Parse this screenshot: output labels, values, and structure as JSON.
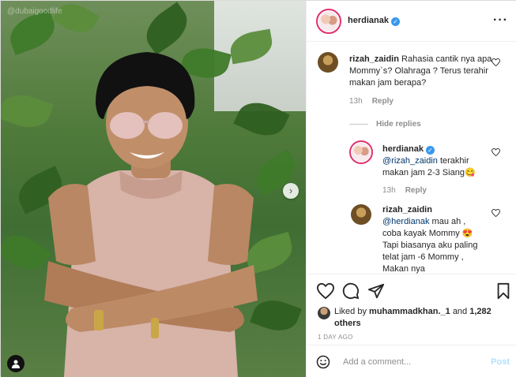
{
  "media": {
    "watermark": "@dubaigoodlife",
    "next_icon": "chevron-right-icon",
    "tag_icon": "user-tag-icon"
  },
  "header": {
    "username": "herdianak",
    "verified_icon": "verified-badge-icon",
    "more_icon": "ellipsis-icon"
  },
  "comments": [
    {
      "username": "rizah_zaidin",
      "text": "Rahasia cantik nya apa Mommy`s? Olahraga ? Terus terahir makan jam berapa?",
      "time": "13h",
      "reply_label": "Reply"
    }
  ],
  "hide_replies_label": "Hide replies",
  "replies": [
    {
      "username": "herdianak",
      "mention": "@rizah_zaidin",
      "text": "terakhir makan jam 2-3 Siang",
      "emoji": "😋",
      "time": "13h",
      "reply_label": "Reply"
    },
    {
      "username": "rizah_zaidin",
      "mention": "@herdianak",
      "text": "mau ah , coba kayak Mommy",
      "emoji": "😍",
      "text2": "Tapi biasanya aku paling telat jam -6 Mommy , Makan nya"
    }
  ],
  "actions": {
    "like_icon": "heart-icon",
    "comment_icon": "comment-icon",
    "share_icon": "paper-plane-icon",
    "save_icon": "bookmark-icon"
  },
  "likes": {
    "prefix": "Liked by",
    "user": "muhammadkhan._1",
    "and": "and",
    "others": "1,282 others"
  },
  "date": "1 DAY AGO",
  "add_comment": {
    "emoji_icon": "smiley-icon",
    "placeholder": "Add a comment...",
    "post_label": "Post"
  },
  "colors": {
    "verified": "#3897f0",
    "link": "#00376b",
    "post_disabled": "#b2dffc",
    "muted": "#8e8e8e"
  }
}
